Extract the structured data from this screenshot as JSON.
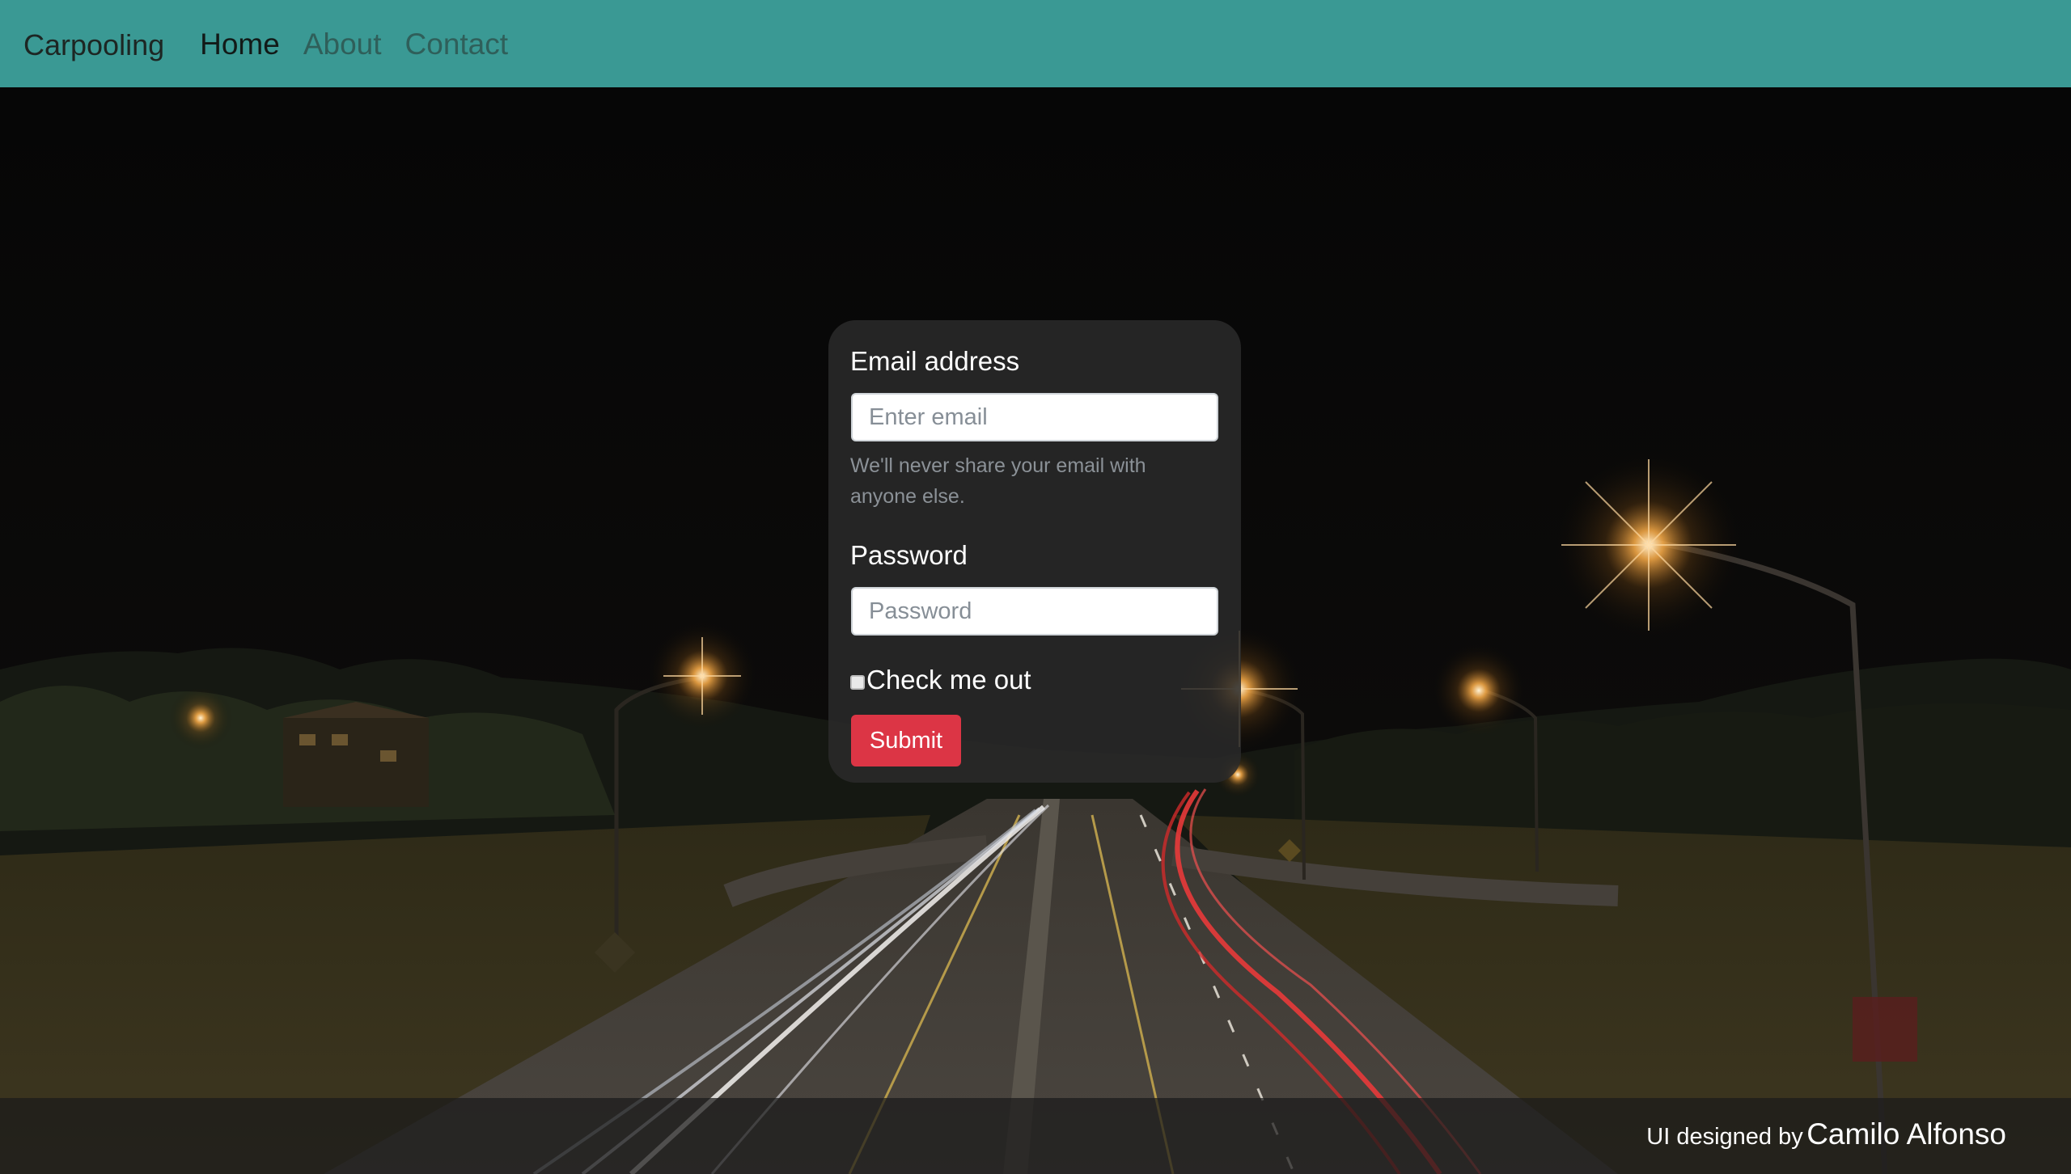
{
  "navbar": {
    "brand": "Carpooling",
    "links": [
      {
        "label": "Home",
        "active": true
      },
      {
        "label": "About",
        "active": false
      },
      {
        "label": "Contact",
        "active": false
      }
    ],
    "bg_color": "#3a9994"
  },
  "form": {
    "email_label": "Email address",
    "email_placeholder": "Enter email",
    "email_value": "",
    "email_help": "We'll never share your email with anyone else.",
    "password_label": "Password",
    "password_placeholder": "Password",
    "password_value": "",
    "checkbox_label": "Check me out",
    "checkbox_checked": false,
    "submit_label": "Submit",
    "submit_color": "#dc3545"
  },
  "footer": {
    "prefix": "UI designed by",
    "author": "Camilo Alfonso"
  },
  "background": {
    "description_icon": "night-highway-photo"
  }
}
